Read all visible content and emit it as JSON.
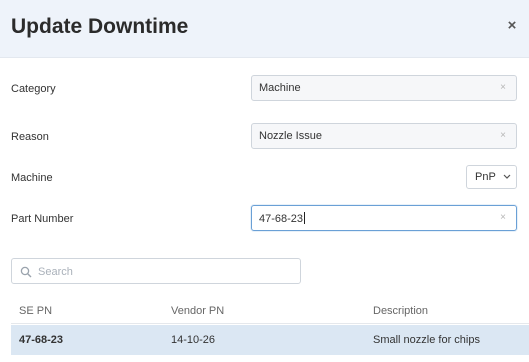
{
  "dialog": {
    "title": "Update Downtime",
    "close_label": "×"
  },
  "form": {
    "category": {
      "label": "Category",
      "value": "Machine",
      "clear": "×"
    },
    "reason": {
      "label": "Reason",
      "value": "Nozzle Issue",
      "clear": "×"
    },
    "machine": {
      "label": "Machine",
      "value": "PnP"
    },
    "part_number": {
      "label": "Part Number",
      "value": "47-68-23",
      "clear": "×"
    }
  },
  "search": {
    "placeholder": "Search"
  },
  "table": {
    "columns": [
      "SE PN",
      "Vendor PN",
      "Description"
    ],
    "rows": [
      {
        "se_pn": "47-68-23",
        "vendor_pn": "14-10-26",
        "description": "Small nozzle for chips"
      }
    ]
  },
  "icons": {
    "search": "search-icon",
    "chevron": "chevron-down-icon"
  },
  "colors": {
    "header_bg": "#eef3fa",
    "selected_row": "#dbe7f3",
    "active_border": "#6aa0d6"
  }
}
